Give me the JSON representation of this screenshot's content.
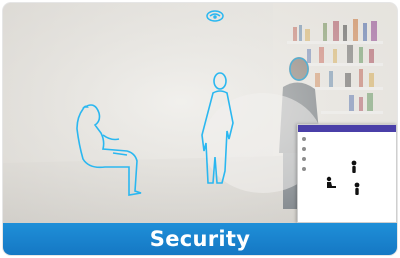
{
  "banner": {
    "title": "Security"
  },
  "colors": {
    "accent": "#1a85d0",
    "outline": "#2ab7f0",
    "phone_status_bar": "#4a3fa8"
  },
  "icons": {
    "overlay_badge": "wifi-signal-icon",
    "silhouettes": [
      "person-sitting-outline",
      "person-standing-outline",
      "person-head-outline"
    ],
    "map_markers": [
      "person-marker",
      "person-marker",
      "sitting-person-marker"
    ]
  }
}
